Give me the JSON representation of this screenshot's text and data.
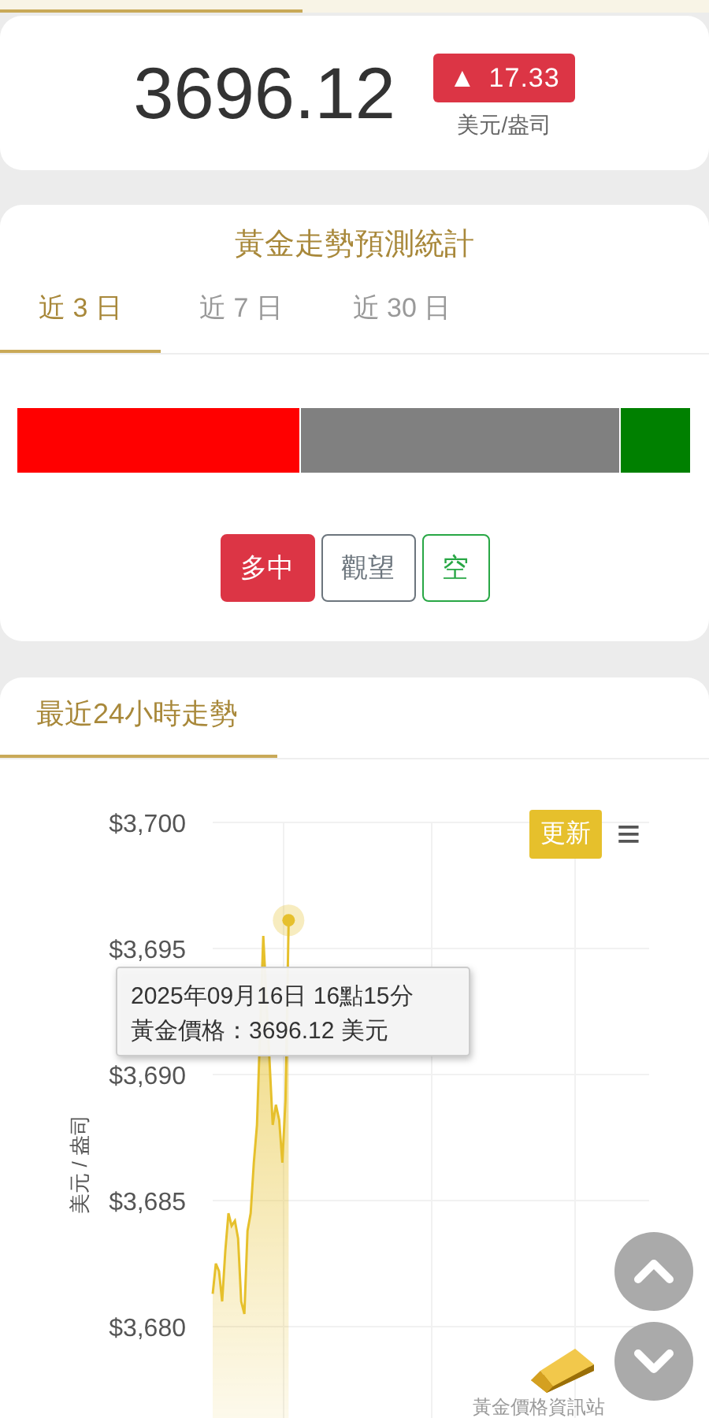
{
  "quote": {
    "price": "3696.12",
    "change_arrow": "▲",
    "change": "17.33",
    "unit": "美元/盎司"
  },
  "forecast": {
    "title": "黃金走勢預測統計",
    "tabs": [
      {
        "label": "近 3 日",
        "selected": true
      },
      {
        "label": "近 7 日",
        "selected": false
      },
      {
        "label": "近 30 日",
        "selected": false
      }
    ],
    "segments": [
      {
        "color": "#ff0000"
      },
      {
        "color": "#808080"
      },
      {
        "color": "#008000"
      }
    ],
    "buttons": [
      {
        "label": "多中",
        "color": "#dc3545",
        "selected": true
      },
      {
        "label": "觀望",
        "color": "#6c757d",
        "selected": false
      },
      {
        "label": "空",
        "color": "#28a745",
        "selected": false
      }
    ]
  },
  "trend": {
    "title": "最近24小時走勢",
    "refresh_label": "更新",
    "menu_label": "≡",
    "chart_data": {
      "type": "area",
      "ylabel": "美元 / 盎司",
      "grid": true,
      "categories": [
        null,
        null,
        null,
        null,
        null,
        null,
        null,
        null,
        null,
        null,
        null,
        null,
        null,
        null,
        null,
        null,
        null,
        null,
        null,
        null,
        null,
        null,
        null,
        null,
        null,
        null,
        null,
        null,
        null,
        null,
        null,
        null,
        null,
        null,
        null,
        null,
        null,
        null,
        null,
        null,
        null,
        null,
        null,
        null,
        null,
        null,
        null,
        null,
        null,
        null,
        null,
        null,
        null,
        null,
        null,
        null,
        null,
        null,
        null,
        null,
        null,
        null,
        null,
        null,
        null,
        null,
        null,
        null,
        null,
        null,
        null,
        null,
        null,
        null,
        null,
        null,
        null,
        null,
        null,
        null,
        null,
        null,
        null,
        null,
        null,
        null,
        null,
        null,
        null,
        null,
        null,
        null,
        null,
        null,
        null,
        null,
        null,
        null,
        null,
        null,
        null,
        null,
        null,
        null,
        null,
        null,
        null,
        null,
        null,
        null,
        null,
        null,
        null,
        null,
        null,
        null,
        null,
        null,
        null,
        null,
        null,
        null,
        null,
        null,
        null,
        null,
        null,
        null,
        null,
        null,
        null,
        null,
        null,
        null,
        null,
        null,
        null,
        null,
        null
      ],
      "ylim": [
        3676.25,
        3700
      ],
      "yticks": [
        {
          "value": 3680,
          "label": "$3,680"
        },
        {
          "value": 3685,
          "label": "$3,685"
        },
        {
          "value": 3690,
          "label": "$3,690"
        },
        {
          "value": 3695,
          "label": "$3,695"
        },
        {
          "value": 3700,
          "label": "$3,700"
        }
      ],
      "series": [
        {
          "name": "黃金價格",
          "color": "#e6c02c",
          "values": [
            3681.3,
            3682.5,
            3682.2,
            3681.0,
            3683.0,
            3684.5,
            3684.0,
            3684.2,
            3683.5,
            3681.0,
            3680.5,
            3683.8,
            3684.5,
            3686.5,
            3688.0,
            null,
            3695.5,
            null,
            null,
            3688.0,
            3688.8,
            3688.2,
            3686.5,
            3689.0,
            3696.12,
            null,
            null,
            null,
            null,
            null,
            null,
            null,
            null,
            null,
            null,
            null,
            null,
            null,
            null,
            null,
            null,
            null,
            null,
            null,
            null,
            null,
            null,
            null,
            null,
            null,
            null,
            null,
            null,
            null,
            null,
            null,
            null,
            null,
            null,
            null,
            null,
            null,
            null,
            null,
            null,
            null,
            null,
            null,
            null,
            null,
            null,
            null,
            null,
            null,
            null,
            null,
            null,
            null,
            null,
            null,
            null,
            null,
            null,
            null,
            null,
            null,
            null,
            null,
            null,
            null,
            null,
            null,
            null,
            null,
            null,
            null,
            null,
            null,
            null,
            null,
            null,
            null,
            null,
            null,
            null,
            null,
            null,
            null,
            null,
            null,
            null,
            null,
            null,
            null,
            null,
            null,
            null,
            null,
            null,
            null,
            null,
            null,
            null,
            null,
            null,
            null,
            null,
            null,
            null,
            null,
            null,
            null,
            null,
            null,
            null,
            null,
            null,
            null,
            null
          ]
        }
      ]
    },
    "tooltip": {
      "line_1": "2025年09月16日 16點15分",
      "line_2": "：3696.12 美元"
    },
    "credit": "黃金價格資訊站"
  }
}
